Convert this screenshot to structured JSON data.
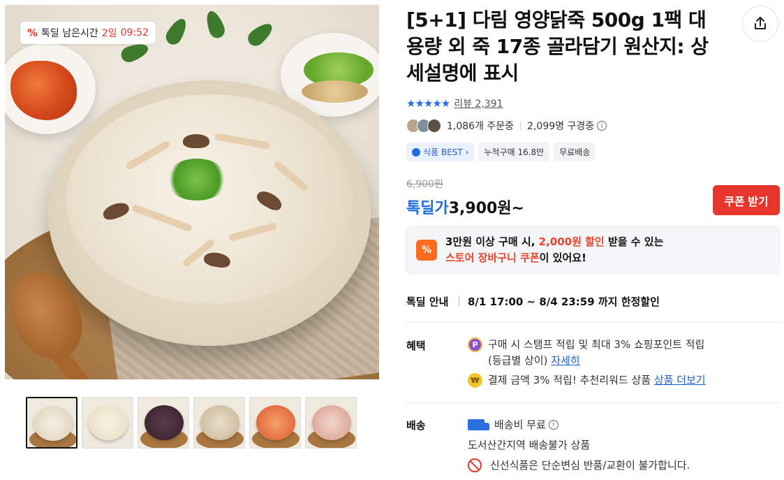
{
  "timer_badge": {
    "icon": "percent-icon",
    "prefix": "톡딜 남은시간",
    "days": "2일",
    "time": "09:52"
  },
  "title": "[5+1] 다림 영양닭죽 500g 1팩 대용량 외 죽 17종 골라담기 원산지: 상세설명에 표시",
  "rating": {
    "stars": "★★★★★",
    "review_label": "리뷰 2,391"
  },
  "buyers": {
    "orders": "1,086개 주문중",
    "viewers": "2,099명 구경중"
  },
  "tags": [
    "식품 BEST",
    "누적구매 16.8만",
    "무료배송"
  ],
  "price": {
    "original": "6,900원",
    "deal_label": "톡딜가",
    "deal_price": "3,900원~",
    "coupon_button": "쿠폰 받기"
  },
  "notice": {
    "line1_a": "3만원 이상 구매 시,",
    "line1_b": "2,000원 할인",
    "line1_c": "받을 수 있는",
    "line2_a": "스토어 장바구니 쿠폰",
    "line2_b": "이 있어요!"
  },
  "deal": {
    "label": "톡딜 안내",
    "period": "8/1 17:00 ~ 8/4 23:59 까지 한정할인"
  },
  "benefits": {
    "label": "혜택",
    "item1": "구매 시 스탬프 적립 및 최대 3% 쇼핑포인트 적립",
    "item1_b": "(등급별 상이)",
    "item1_link": "자세히",
    "item2": "결제 금액 3% 적립! 추천리워드 상품",
    "item2_link": "상품 더보기"
  },
  "shipping": {
    "label": "배송",
    "fee": "배송비 무료",
    "remote": "도서산간지역 배송불가 상품",
    "fresh": "신선식품은 단순변심 반품/교환이 불가합니다."
  },
  "colors": {
    "accent_blue": "#1e6ce8",
    "accent_red": "#e8352c",
    "accent_orange": "#ff6a1f"
  },
  "thumb_count": 6
}
